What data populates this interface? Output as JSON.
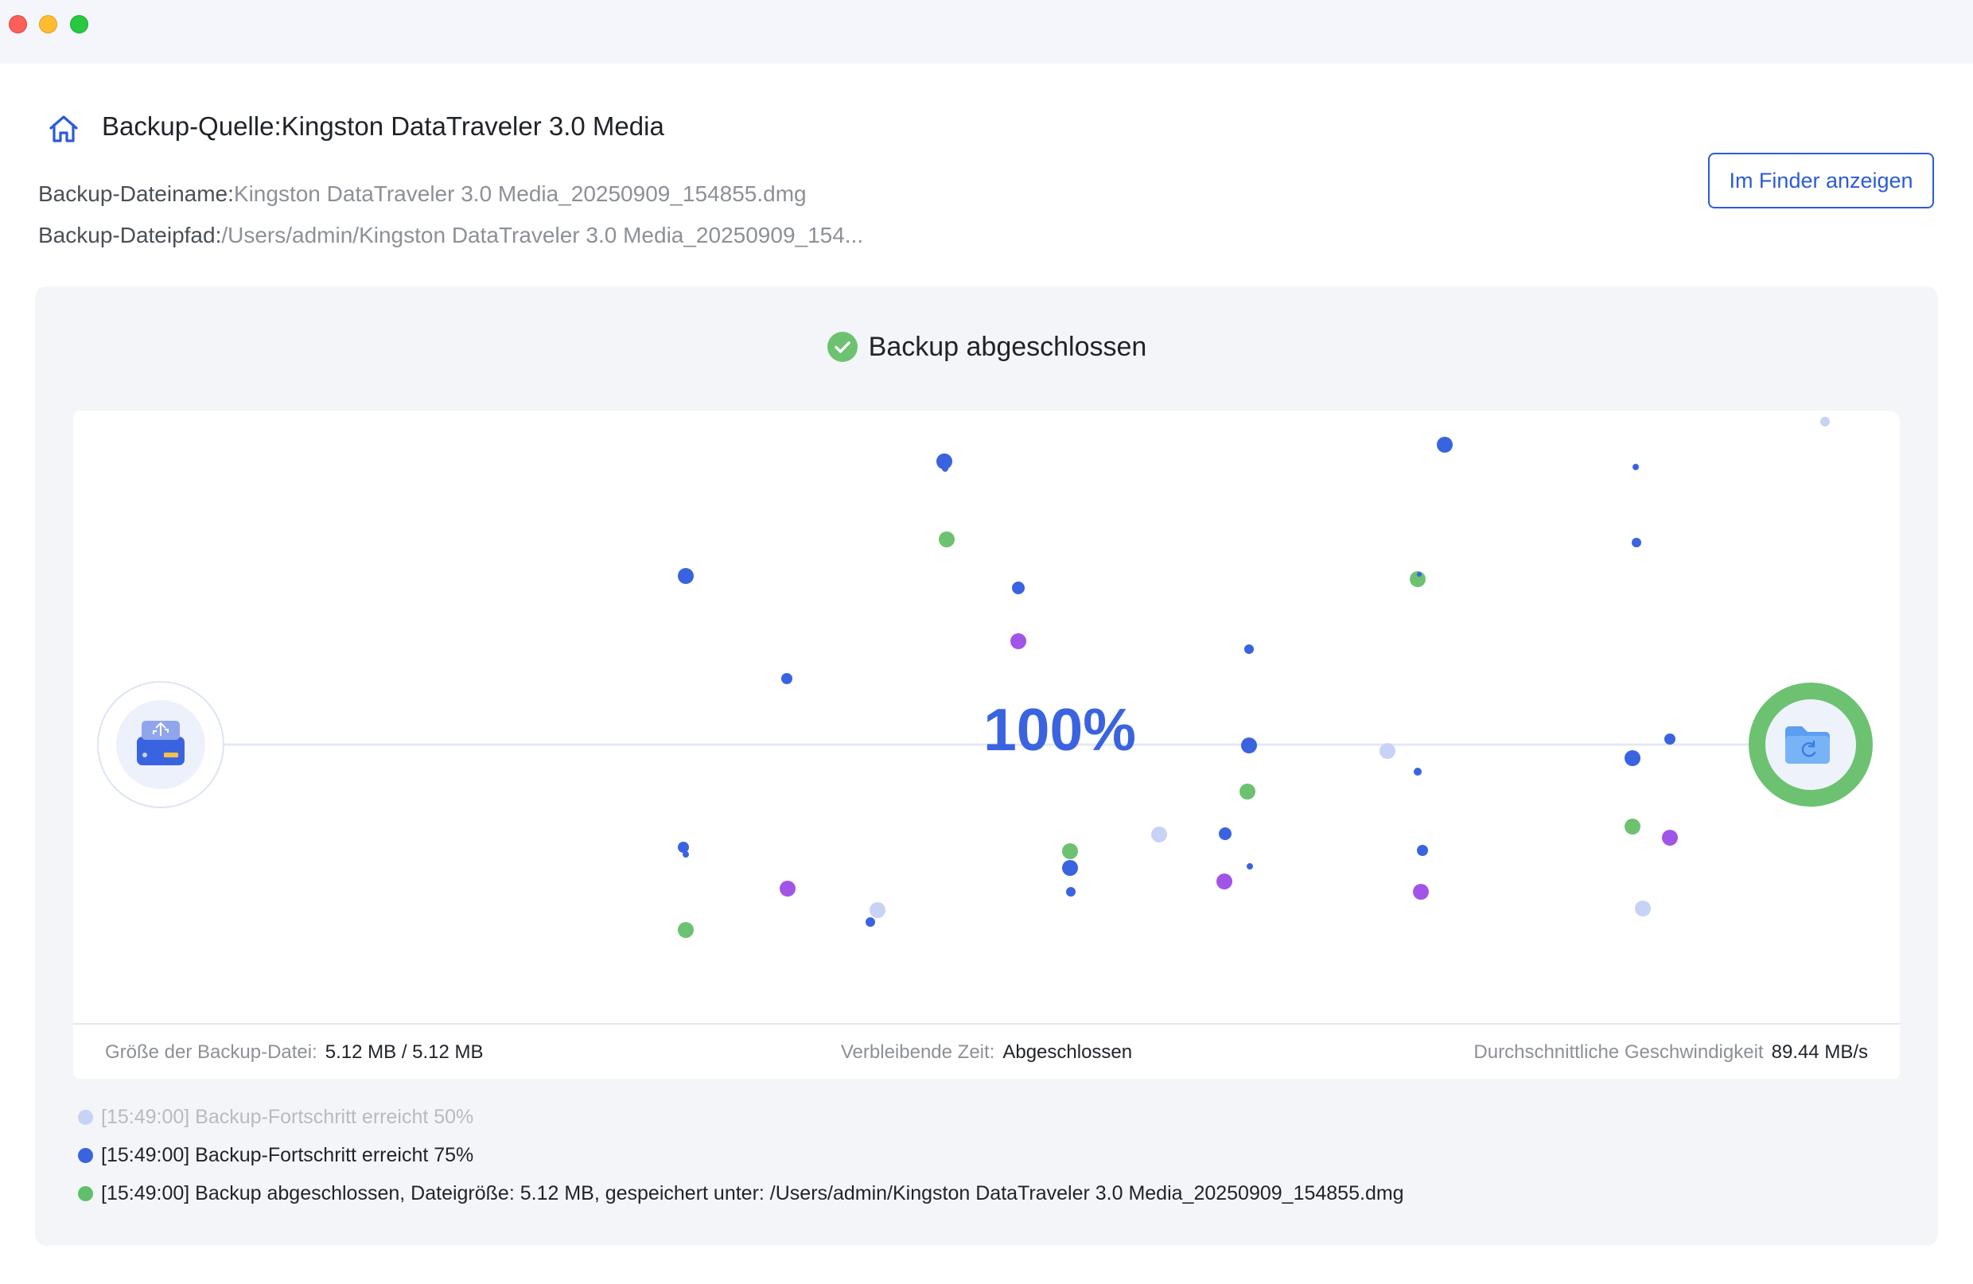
{
  "window": {
    "traffic_lights": [
      "close",
      "minimize",
      "zoom"
    ]
  },
  "header": {
    "source_label": "Backup-Quelle:Kingston DataTraveler 3.0 Media",
    "filename_label": "Backup-Dateiname:",
    "filename_value": "Kingston DataTraveler 3.0 Media_20250909_154855.dmg",
    "path_label": "Backup-Dateipfad:",
    "path_value": "/Users/admin/Kingston DataTraveler 3.0 Media_20250909_154...",
    "finder_button": "Im Finder anzeigen"
  },
  "status": {
    "icon": "check-circle-icon",
    "text": "Backup abgeschlossen"
  },
  "progress": {
    "percent_text": "100%",
    "value": 1.0,
    "source_icon": "usb-drive-icon",
    "target_icon": "folder-sync-icon"
  },
  "stats": {
    "size_label": "Größe der Backup-Datei:",
    "size_value": "5.12 MB / 5.12 MB",
    "time_label": "Verbleibende Zeit:",
    "time_value": "Abgeschlossen",
    "speed_label": "Durchschnittliche Geschwindigkeit",
    "speed_value": "89.44 MB/s"
  },
  "log": [
    "[15:49:00] Backup-Fortschritt erreicht 50%",
    "[15:49:00] Backup-Fortschritt erreicht 75%",
    "[15:49:00] Backup abgeschlossen, Dateigröße: 5.12 MB, gespeichert unter: /Users/admin/Kingston DataTraveler 3.0 Media_20250909_154855.dmg"
  ],
  "colors": {
    "accent": "#3a63e0",
    "success": "#6cc270",
    "particle_purple": "#a155e8",
    "particle_light": "#c7d3f5"
  }
}
